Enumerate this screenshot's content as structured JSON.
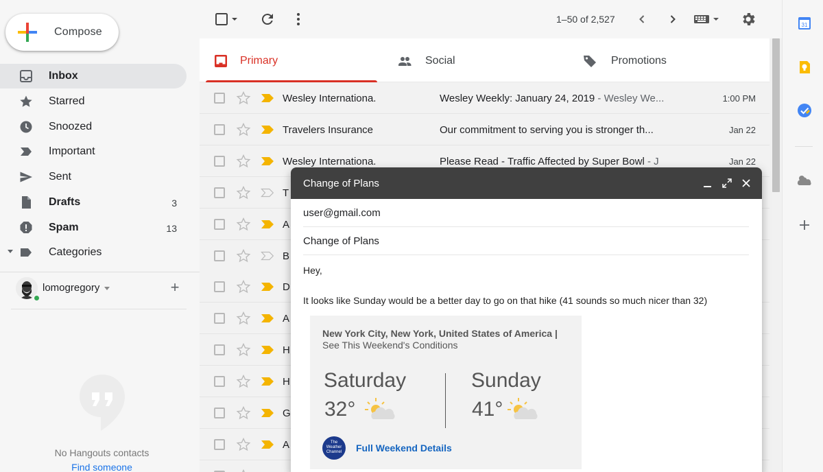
{
  "compose": {
    "label": "Compose"
  },
  "nav": [
    {
      "label": "Inbox",
      "count": "",
      "bold": true,
      "icon": "inbox-icon"
    },
    {
      "label": "Starred",
      "count": "",
      "bold": false,
      "icon": "star-icon"
    },
    {
      "label": "Snoozed",
      "count": "",
      "bold": false,
      "icon": "clock-icon"
    },
    {
      "label": "Important",
      "count": "",
      "bold": false,
      "icon": "important-icon"
    },
    {
      "label": "Sent",
      "count": "",
      "bold": false,
      "icon": "send-icon"
    },
    {
      "label": "Drafts",
      "count": "3",
      "bold": true,
      "icon": "draft-icon"
    },
    {
      "label": "Spam",
      "count": "13",
      "bold": true,
      "icon": "spam-icon"
    },
    {
      "label": "Categories",
      "count": "",
      "bold": false,
      "icon": "label-icon"
    }
  ],
  "user": {
    "name": "lomogregory"
  },
  "hangouts": {
    "empty_text": "No Hangouts contacts",
    "find_link": "Find someone"
  },
  "toolbar": {
    "pager": "1–50 of 2,527"
  },
  "tabs": [
    {
      "label": "Primary",
      "active": true,
      "icon": "inbox-tab-icon"
    },
    {
      "label": "Social",
      "active": false,
      "icon": "people-icon"
    },
    {
      "label": "Promotions",
      "active": false,
      "icon": "tag-icon"
    }
  ],
  "emails": [
    {
      "sender": "Wesley Internationa.",
      "subject": "Wesley Weekly: January 24, 2019",
      "snippet": " - Wesley We...",
      "date": "1:00 PM",
      "important": true
    },
    {
      "sender": "Travelers Insurance",
      "subject": "Our commitment to serving you is stronger th...",
      "snippet": "",
      "date": "Jan 22",
      "important": true
    },
    {
      "sender": "Wesley Internationa.",
      "subject": "Please Read - Traffic Affected by Super Bowl",
      "snippet": " - J",
      "date": "Jan 22",
      "important": true
    },
    {
      "sender": "T",
      "subject": "",
      "snippet": "",
      "date": "",
      "important": false
    },
    {
      "sender": "A",
      "subject": "",
      "snippet": "",
      "date": "",
      "important": true
    },
    {
      "sender": "B",
      "subject": "",
      "snippet": "",
      "date": "",
      "important": false
    },
    {
      "sender": "D",
      "subject": "",
      "snippet": "",
      "date": "",
      "important": true
    },
    {
      "sender": "A",
      "subject": "",
      "snippet": "",
      "date": "",
      "important": true
    },
    {
      "sender": "H",
      "subject": "",
      "snippet": "",
      "date": "",
      "important": true
    },
    {
      "sender": "H",
      "subject": "",
      "snippet": "",
      "date": "",
      "important": true
    },
    {
      "sender": "G",
      "subject": "",
      "snippet": "",
      "date": "",
      "important": true
    },
    {
      "sender": "A",
      "subject": "",
      "snippet": "",
      "date": "",
      "important": true
    },
    {
      "sender": "",
      "subject": "",
      "snippet": "",
      "date": "",
      "important": true
    }
  ],
  "compose_window": {
    "title": "Change of Plans",
    "to": "user@gmail.com",
    "subject": "Change of Plans",
    "greeting": "Hey,",
    "body": "It looks like Sunday would be a better day to go on that hike (41 sounds so much nicer than 32)",
    "weather": {
      "location": "New York City, New York, United States of America |",
      "link": "See This Weekend's Conditions",
      "day1": "Saturday",
      "temp1": "32°",
      "day2": "Sunday",
      "temp2": "41°",
      "logo_text": "The Weather Channel",
      "details_link": "Full Weekend Details"
    }
  },
  "right_panel": {
    "calendar_day": "31"
  },
  "colors": {
    "accent_red": "#d93025",
    "important_yellow": "#f4b400",
    "link_blue": "#1a73e8"
  }
}
